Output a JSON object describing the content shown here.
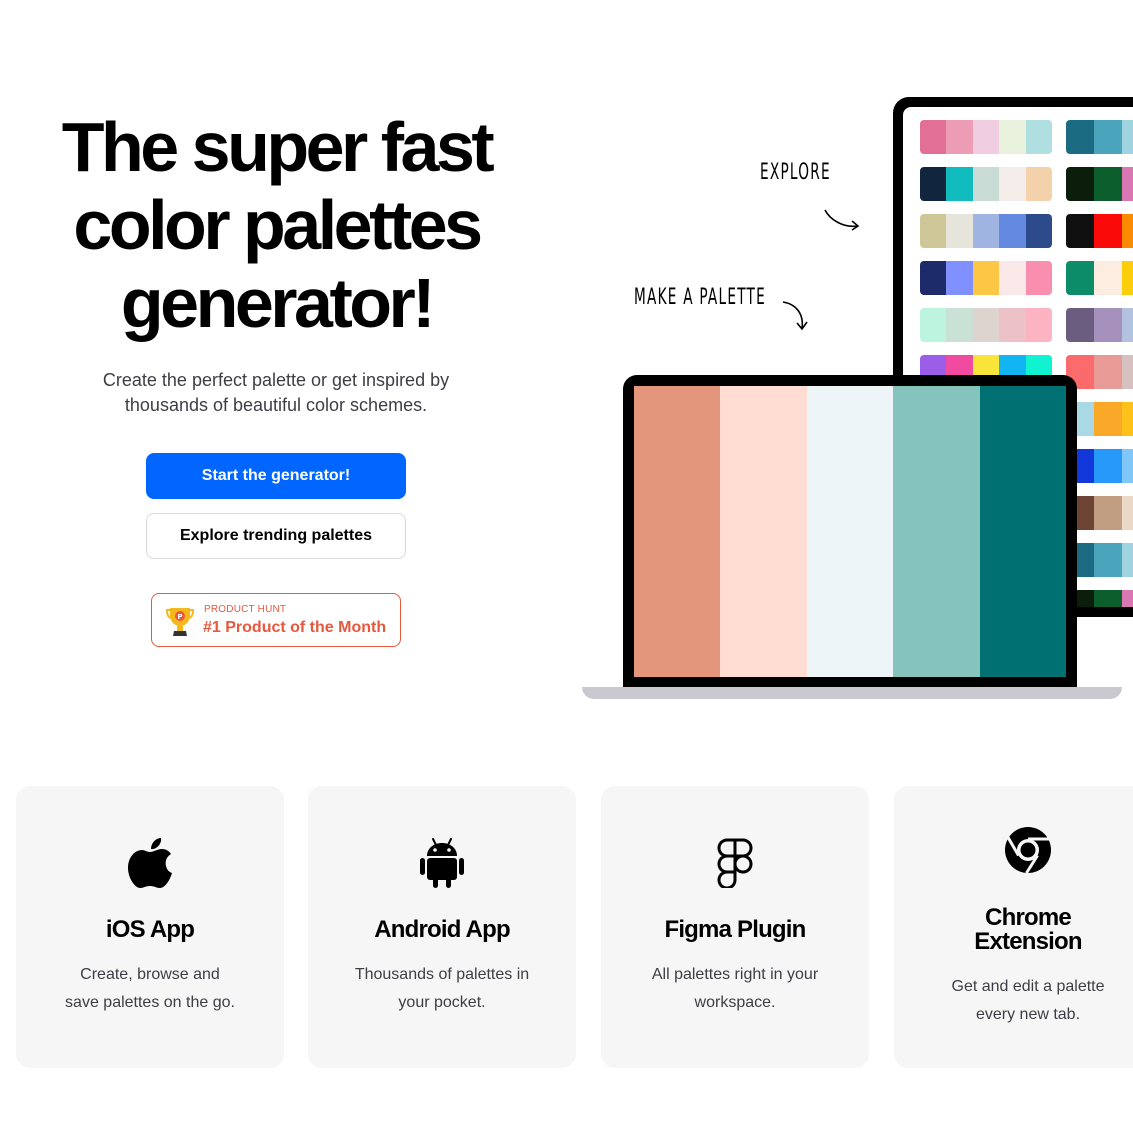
{
  "hero": {
    "title_lines": [
      "The super fast",
      "color palettes",
      "generator!"
    ],
    "subtitle": "Create the perfect palette or get inspired by thousands of beautiful color schemes.",
    "primary_button": "Start the generator!",
    "secondary_button": "Explore trending palettes",
    "badge": {
      "label_small": "PRODUCT HUNT",
      "label_big": "#1 Product of the Month",
      "color": "#e8583d"
    }
  },
  "illustration": {
    "explore_label": "EXPLORE",
    "make_label": "MAKE A PALETTE",
    "laptop_palette": [
      "#e3967b",
      "#ffddd3",
      "#edf5f8",
      "#85c4bd",
      "#007073"
    ],
    "monitor_palettes_left": [
      [
        "#e26f96",
        "#ec9cb5",
        "#f0cde0",
        "#e8f2dc",
        "#b0dfe2"
      ],
      [
        "#11253f",
        "#10bcbd",
        "#c8dcd5",
        "#f5ede9",
        "#f3d1ab"
      ],
      [
        "#cfc697",
        "#e7e4dc",
        "#a0b4e2",
        "#6389e0",
        "#2d4a8a"
      ],
      [
        "#1e2b6b",
        "#8090ff",
        "#fbc744",
        "#fbe9ea",
        "#f98eae"
      ],
      [
        "#bdf4df",
        "#cae2d6",
        "#ddd4cf",
        "#ecc1c8",
        "#fcb3c2"
      ],
      [
        "#9b5ee8",
        "#f04aa1",
        "#f9e43a",
        "#12b5f2",
        "#11f2d0"
      ]
    ],
    "monitor_palettes_right": [
      [
        "#1b6b83",
        "#4aa4bc",
        "#9ed3df"
      ],
      [
        "#0b1e0c",
        "#0c5f2d",
        "#d877b1"
      ],
      [
        "#0f0f0f",
        "#fb0a0a",
        "#fc8b02"
      ],
      [
        "#0c8c68",
        "#fdece0",
        "#fccd0a"
      ],
      [
        "#6a5d80",
        "#a691bd",
        "#b3c3df"
      ],
      [
        "#fb6b6b",
        "#e79a96",
        "#d6c0c0"
      ],
      [
        "#aad9e6",
        "#f9a827",
        "#fcc21a"
      ],
      [
        "#1237db",
        "#2799f9",
        "#7fc7f9"
      ],
      [
        "#6d4434",
        "#c19d82",
        "#ead9c6"
      ],
      [
        "#1b6b83",
        "#4aa4bc",
        "#9ed3df"
      ],
      [
        "#0b1e0c",
        "#0c5f2d",
        "#d877b1"
      ]
    ],
    "accent": "#0066ff"
  },
  "cards": [
    {
      "icon": "apple-icon",
      "title": "iOS App",
      "desc_lines": [
        "Create, browse and",
        "save palettes on the go."
      ]
    },
    {
      "icon": "android-icon",
      "title": "Android App",
      "desc_lines": [
        "Thousands of palettes in",
        "your pocket."
      ]
    },
    {
      "icon": "figma-icon",
      "title": "Figma Plugin",
      "desc_lines": [
        "All palettes right in your",
        "workspace."
      ]
    },
    {
      "icon": "chrome-icon",
      "title_lines": [
        "Chrome",
        "Extension"
      ],
      "desc_lines": [
        "Get and edit a palette",
        "every new tab."
      ]
    }
  ]
}
